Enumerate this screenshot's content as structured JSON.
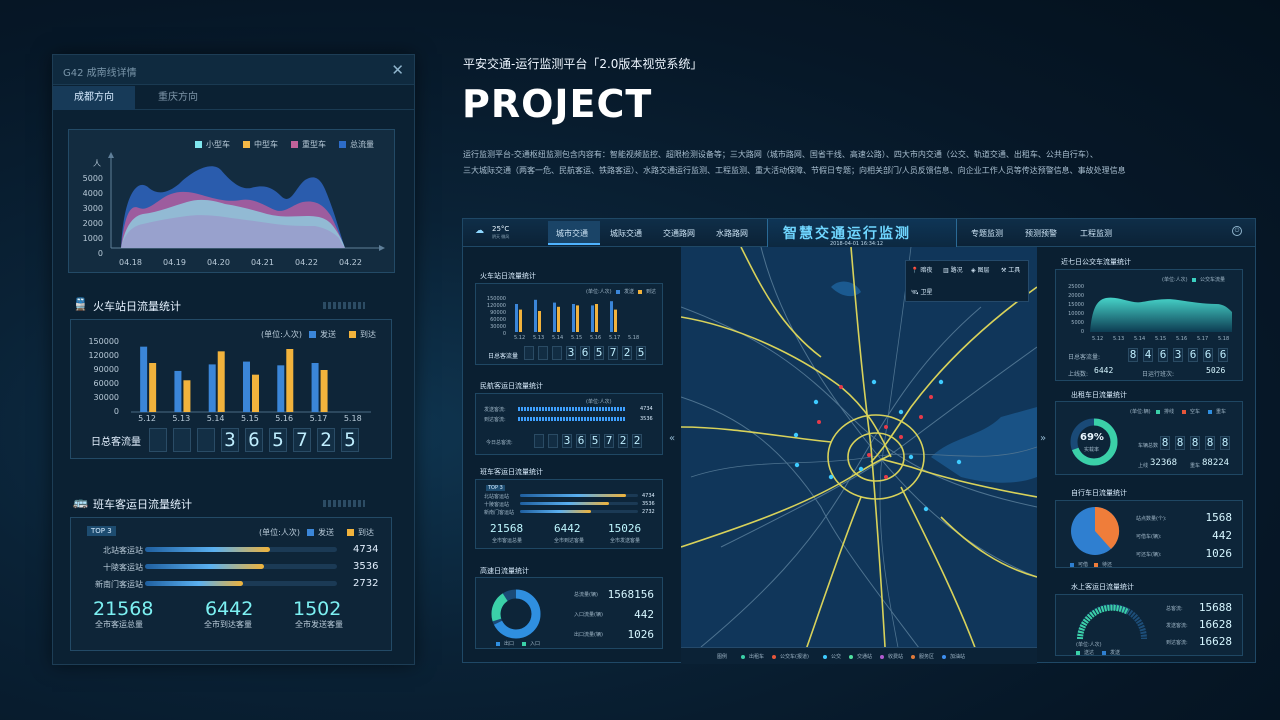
{
  "panel": {
    "title": "G42 成南线详情",
    "tabs": [
      "成都方向",
      "重庆方向"
    ],
    "area": {
      "legend": [
        "小型车",
        "中型车",
        "重型车",
        "总流量"
      ],
      "legend_colors": [
        "#7fe6ee",
        "#f4b846",
        "#c0629a",
        "#2d6cc8"
      ],
      "yunit": "人",
      "yticks": [
        "5000",
        "4000",
        "3000",
        "2000",
        "1000",
        "0"
      ],
      "xticks": [
        "04.18",
        "04.19",
        "04.20",
        "04.21",
        "04.22",
        "04.22"
      ]
    },
    "train": {
      "title": "火车站日流量统计",
      "unit": "(单位:人次)",
      "legend": [
        "发送",
        "到达"
      ],
      "yticks": [
        "150000",
        "120000",
        "90000",
        "60000",
        "30000",
        "0"
      ],
      "xticks": [
        "5.12",
        "5.13",
        "5.14",
        "5.15",
        "5.16",
        "5.17",
        "5.18"
      ],
      "send": [
        140000,
        88000,
        102000,
        108000,
        100000,
        105000,
        0
      ],
      "arrive": [
        105000,
        68000,
        130000,
        80000,
        135000,
        90000,
        0
      ],
      "total_label": "日总客流量",
      "digits": [
        "",
        "",
        "",
        "3",
        "6",
        "5",
        "7",
        "2",
        "5"
      ]
    },
    "bus": {
      "title": "班车客运日流量统计",
      "top": "TOP 3",
      "unit": "(单位:人次)",
      "legend": [
        "发送",
        "到达"
      ],
      "rows": [
        {
          "name": "北站客运站",
          "value": "4734",
          "ratio": 0.65
        },
        {
          "name": "十陵客运站",
          "value": "3536",
          "ratio": 0.62
        },
        {
          "name": "新南门客运站",
          "value": "2732",
          "ratio": 0.51
        }
      ],
      "stats": [
        {
          "value": "21568",
          "label": "全市客运总量"
        },
        {
          "value": "6442",
          "label": "全市到达客量"
        },
        {
          "value": "1502",
          "label": "全市发送客量"
        }
      ]
    }
  },
  "project": {
    "subtitle": "平安交通-运行监测平台「2.0版本视觉系统」",
    "heading": "PROJECT",
    "desc1": "运行监测平台-交通枢纽监测包含内容有：智能视频监控、超限检测设备等；三大路网（城市路网、国省干线、高速公路）、四大市内交通（公交、轨道交通、出租车、公共自行车）、",
    "desc2": "三大城际交通（两客一危、民航客运、铁路客运）、水路交通运行监测、工程监测、重大活动保障、节假日专题；向相关部门/人员反馈信息、向企业工作人员等传达预警信息、事故处理信息"
  },
  "dashboard": {
    "temp": "25°C",
    "weather": "阴天 微风",
    "nav_left": [
      "城市交通",
      "城际交通",
      "交通路网",
      "水路路网"
    ],
    "title": "智慧交通运行监测",
    "datetime": "2018-04-01  16:34:12",
    "nav_right": [
      "专题监测",
      "预测预警",
      "工程监测"
    ],
    "train_mini": {
      "title": "火车站日流量统计",
      "unit": "(单位:人次)",
      "legend": [
        "发送",
        "到达"
      ],
      "total_label": "日总客流量",
      "digits": [
        "3",
        "6",
        "5",
        "7",
        "2",
        "5"
      ],
      "xticks": [
        "5.12",
        "5.13",
        "5.14",
        "5.15",
        "5.16",
        "5.17",
        "5.18"
      ]
    },
    "air": {
      "title": "民航客运日流量统计",
      "unit": "(单位:人次)",
      "rows": [
        {
          "name": "发送客流:",
          "value": "4734"
        },
        {
          "name": "到达客流:",
          "value": "3536"
        }
      ],
      "total_label": "今日总客流:",
      "digits": [
        "3",
        "6",
        "5",
        "7",
        "2",
        "2"
      ]
    },
    "bus_mini": {
      "title": "班车客运日流量统计",
      "top": "TOP 3",
      "rows": [
        {
          "name": "北站客运站",
          "value": "4734"
        },
        {
          "name": "十陵客运站",
          "value": "3536"
        },
        {
          "name": "新南门客运站",
          "value": "2732"
        }
      ],
      "stats": [
        {
          "value": "21568",
          "label": "全市客运总量"
        },
        {
          "value": "6442",
          "label": "全市到达客量"
        },
        {
          "value": "15026",
          "label": "全市发送客量"
        }
      ]
    },
    "highway": {
      "title": "高速日流量统计",
      "rows": [
        {
          "name": "总流量(辆)",
          "value": "1568156"
        },
        {
          "name": "入口流量(辆)",
          "value": "442"
        },
        {
          "name": "出口流量(辆)",
          "value": "1026"
        }
      ],
      "legend": [
        "出口",
        "入口"
      ]
    },
    "map": {
      "tools": [
        "暗夜",
        "路况",
        "图层",
        "工具",
        "卫星"
      ],
      "legend_label": "图例",
      "legend": [
        "出租车",
        "公交车(报道)",
        "公交",
        "交通站",
        "收费站",
        "服务区",
        "加油站"
      ]
    },
    "weekly_bus": {
      "title": "近七日公交车流量统计",
      "unit": "(单位:人次)",
      "legend": "公交车流量",
      "yticks": [
        "25000",
        "20000",
        "15000",
        "10000",
        "5000",
        "0"
      ],
      "xticks": [
        "5.12",
        "5.13",
        "5.14",
        "5.15",
        "5.16",
        "5.17",
        "5.18"
      ],
      "total_label": "日总客流量:",
      "digits": [
        "8",
        "4",
        "6",
        "3",
        "6",
        "6",
        "6"
      ],
      "lines_label": "上线数:",
      "lines_value": "6442",
      "runs_label": "日运行班次:",
      "runs_value": "5026"
    },
    "taxi": {
      "title": "出租车日流量统计",
      "unit": "(单位:辆)",
      "legend": [
        "排线",
        "空车",
        "重车"
      ],
      "percent": "69%",
      "percent_label": "实载率",
      "total_label": "车辆总数",
      "digits": [
        "8",
        "8",
        "8",
        "8",
        "8"
      ],
      "online_label": "上线",
      "online_value": "32368",
      "heavy_label": "重车",
      "heavy_value": "88224"
    },
    "bike": {
      "title": "自行车日流量统计",
      "rows": [
        {
          "name": "站点数量(个):",
          "value": "1568"
        },
        {
          "name": "可借车(辆):",
          "value": "442"
        },
        {
          "name": "可还车(辆):",
          "value": "1026"
        }
      ],
      "legend": [
        "可借",
        "待还"
      ]
    },
    "water": {
      "title": "水上客运日流量统计",
      "rows": [
        {
          "name": "总客流:",
          "value": "15688"
        },
        {
          "name": "发送客流:",
          "value": "16628"
        },
        {
          "name": "到达客流:",
          "value": "16628"
        }
      ],
      "unit": "(单位:人次)",
      "legend": [
        "送达",
        "发送"
      ]
    }
  }
}
